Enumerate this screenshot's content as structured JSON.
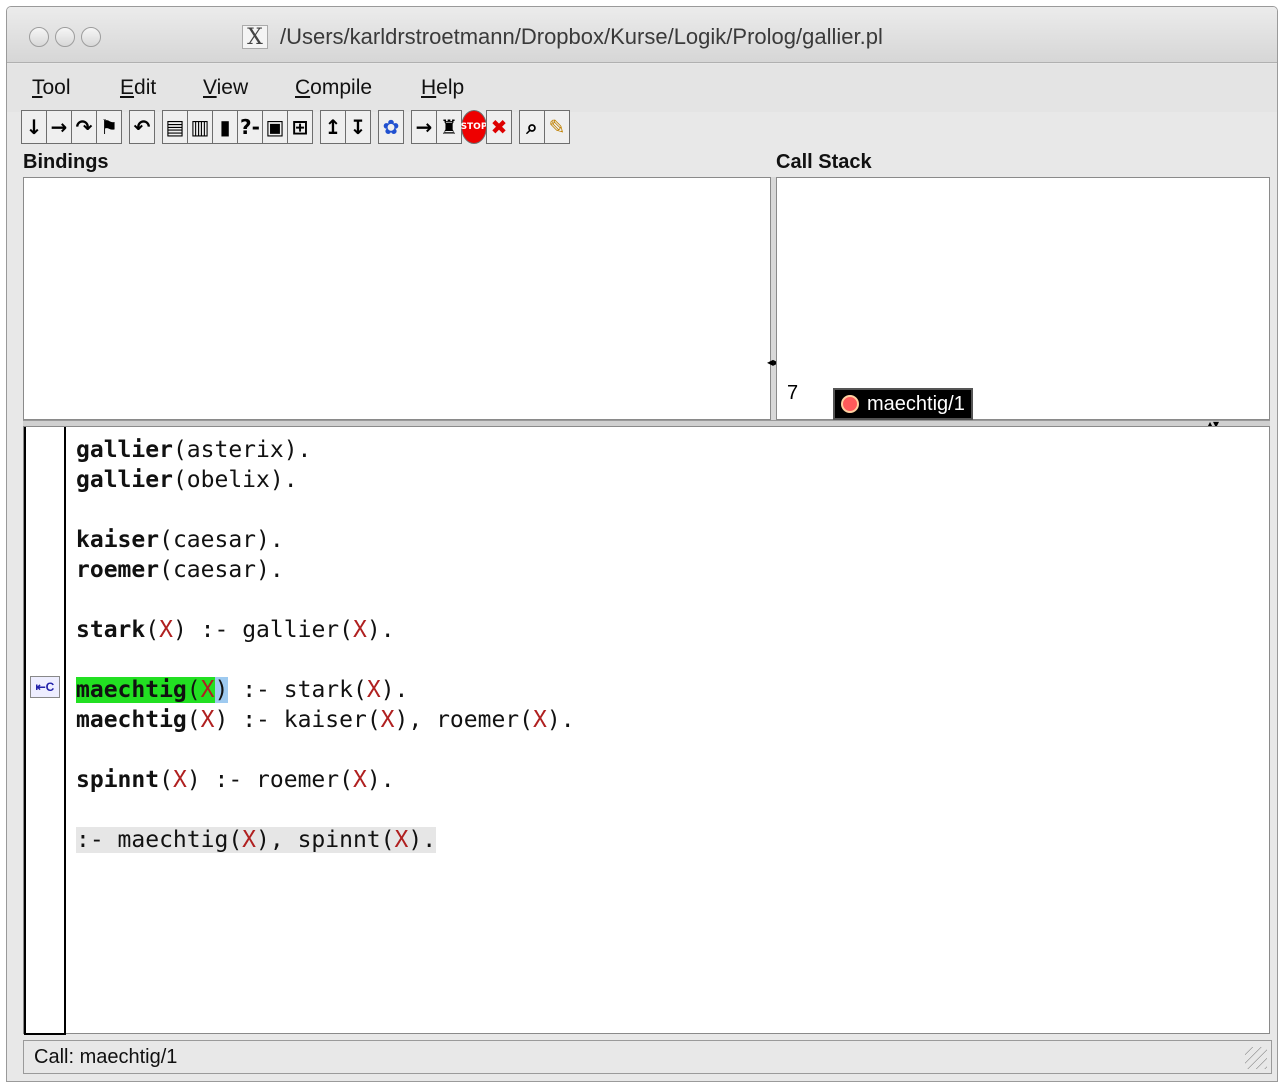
{
  "window": {
    "title": "/Users/karldrstroetmann/Dropbox/Kurse/Logik/Prolog/gallier.pl",
    "title_icon": "X"
  },
  "menu": [
    {
      "underline": "T",
      "rest": "ool"
    },
    {
      "underline": "E",
      "rest": "dit"
    },
    {
      "underline": "V",
      "rest": "iew"
    },
    {
      "underline": "C",
      "rest": "ompile"
    },
    {
      "underline": "H",
      "rest": "elp"
    }
  ],
  "toolbar": {
    "groups": [
      [
        "↓",
        "→",
        "↷",
        "⚑"
      ],
      [
        "↶"
      ],
      [
        "▤",
        "▥",
        "▮",
        "?-",
        "▣",
        "⊞"
      ],
      [
        "↥",
        "↧"
      ],
      [
        "✿"
      ],
      [
        "→",
        "♜",
        "STOP",
        "✖"
      ],
      [
        "⌕",
        "✎"
      ]
    ],
    "icon_names": [
      "step-into-icon",
      "skip-icon",
      "finish-icon",
      "retry-marker-icon",
      "undo-icon",
      "edit-icon",
      "breakpoint-icon",
      "pause-icon",
      "query-icon",
      "console-icon",
      "frame-icon",
      "up-icon",
      "down-icon",
      "butterfly-icon",
      "leap-icon",
      "spy-icon",
      "stop-icon",
      "abort-icon",
      "search-icon",
      "pencil-icon"
    ]
  },
  "bindings": {
    "label": "Bindings"
  },
  "callstack": {
    "label": "Call Stack",
    "depth": "7",
    "frame": "maechtig/1"
  },
  "code": {
    "lines": [
      [
        {
          "t": "gallier",
          "c": "b"
        },
        {
          "t": "(asterix)."
        }
      ],
      [
        {
          "t": "gallier",
          "c": "b"
        },
        {
          "t": "(obelix)."
        }
      ],
      [],
      [
        {
          "t": "kaiser",
          "c": "b"
        },
        {
          "t": "(caesar)."
        }
      ],
      [
        {
          "t": "roemer",
          "c": "b"
        },
        {
          "t": "(caesar)."
        }
      ],
      [],
      [
        {
          "t": "stark",
          "c": "b"
        },
        {
          "t": "("
        },
        {
          "t": "X",
          "c": "v"
        },
        {
          "t": ") :- gallier("
        },
        {
          "t": "X",
          "c": "v"
        },
        {
          "t": ")."
        }
      ],
      [],
      [
        {
          "t": "maechtig",
          "c": "b hl-green"
        },
        {
          "t": "(",
          "c": "hl-green"
        },
        {
          "t": "X",
          "c": "v hl-green"
        },
        {
          "t": ")",
          "c": "hl-blue"
        },
        {
          "t": " :- stark("
        },
        {
          "t": "X",
          "c": "v"
        },
        {
          "t": ")."
        }
      ],
      [
        {
          "t": "maechtig",
          "c": "b"
        },
        {
          "t": "("
        },
        {
          "t": "X",
          "c": "v"
        },
        {
          "t": ") :- kaiser("
        },
        {
          "t": "X",
          "c": "v"
        },
        {
          "t": "), roemer("
        },
        {
          "t": "X",
          "c": "v"
        },
        {
          "t": ")."
        }
      ],
      [],
      [
        {
          "t": "spinnt",
          "c": "b"
        },
        {
          "t": "("
        },
        {
          "t": "X",
          "c": "v"
        },
        {
          "t": ") :- roemer("
        },
        {
          "t": "X",
          "c": "v"
        },
        {
          "t": ")."
        }
      ],
      [],
      [
        {
          "t": ":- maechtig(",
          "c": "directive"
        },
        {
          "t": "X",
          "c": "v directive"
        },
        {
          "t": "), spinnt(",
          "c": "directive"
        },
        {
          "t": "X",
          "c": "v directive"
        },
        {
          "t": ").",
          "c": "directive"
        }
      ]
    ],
    "gutter_icon": "⇤C"
  },
  "status": {
    "text": "Call: maechtig/1"
  }
}
